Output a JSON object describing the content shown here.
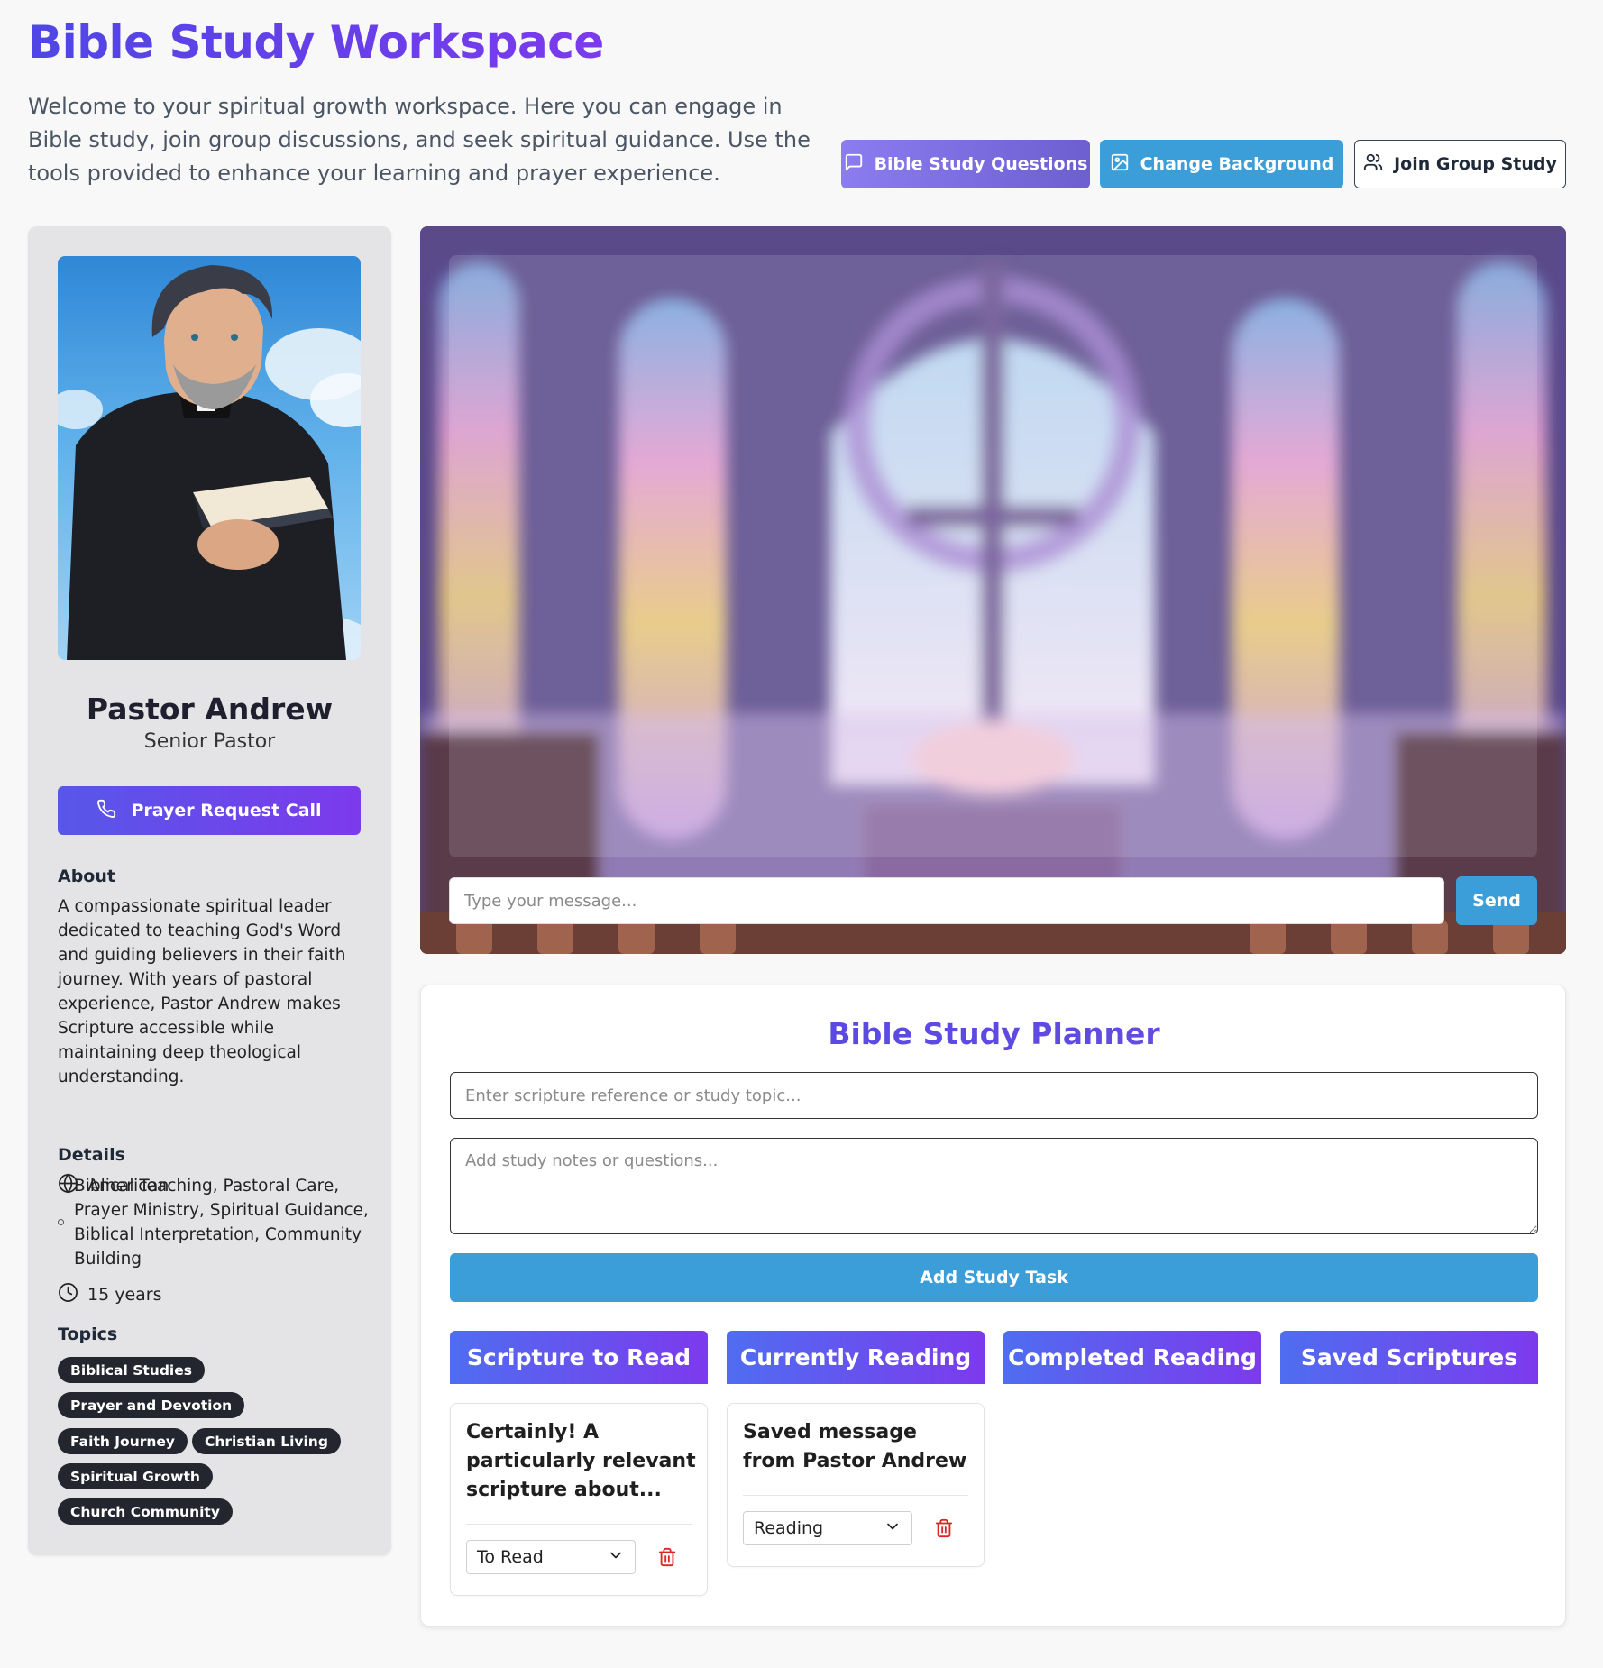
{
  "header": {
    "title": "Bible Study Workspace",
    "intro": "Welcome to your spiritual growth workspace. Here you can engage in Bible study, join group discussions, and seek spiritual guidance. Use the tools provided to enhance your learning and prayer experience.",
    "buttons": {
      "questions": "Bible Study Questions",
      "background": "Change Background",
      "join": "Join Group Study"
    }
  },
  "profile": {
    "name": "Pastor Andrew",
    "role": "Senior Pastor",
    "call_button": "Prayer Request Call",
    "about_label": "About",
    "about": "A compassionate spiritual leader dedicated to teaching God's Word and guiding believers in their faith journey. With years of pastoral experience, Pastor Andrew makes Scripture accessible while maintaining deep theological understanding.",
    "details_label": "Details",
    "nationality": "American",
    "specialties": "Biblical Teaching, Pastoral Care, Prayer Ministry, Spiritual Guidance, Biblical Interpretation, Community Building",
    "experience": "15 years",
    "topics_label": "Topics",
    "topics": [
      "Biblical Studies",
      "Prayer and Devotion",
      "Faith Journey",
      "Christian Living",
      "Spiritual Growth",
      "Church Community"
    ]
  },
  "chat": {
    "placeholder": "Type your message...",
    "send": "Send"
  },
  "planner": {
    "title": "Bible Study Planner",
    "topic_placeholder": "Enter scripture reference or study topic...",
    "notes_placeholder": "Add study notes or questions...",
    "add_button": "Add Study Task",
    "columns": [
      "Scripture to Read",
      "Currently Reading",
      "Completed Reading",
      "Saved Scriptures"
    ],
    "cards": [
      {
        "text": "Certainly! A particularly relevant scripture about...",
        "status": "To Read"
      },
      {
        "text": "Saved message from Pastor Andrew",
        "status": "Reading"
      }
    ]
  },
  "colors": {
    "accent": "#5b4fe0",
    "button_blue": "#3b9ed8",
    "tag_bg": "#23262e",
    "delete_red": "#dc2626"
  },
  "icons": {
    "questions": "message-square-icon",
    "background": "image-icon",
    "join": "users-icon",
    "call": "phone-icon",
    "nationality": "globe-icon",
    "specialties": "circle-icon",
    "experience": "clock-icon",
    "dropdown": "chevron-down-icon",
    "delete": "trash-icon"
  }
}
